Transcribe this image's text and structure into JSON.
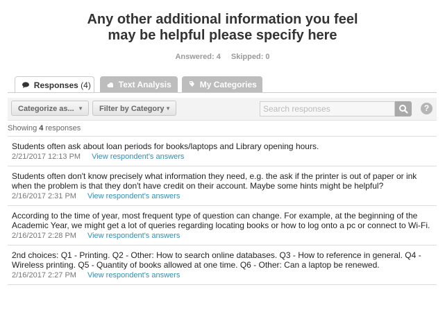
{
  "question": {
    "title_line1": "Any other additional information you feel",
    "title_line2": "may be helpful please specify here"
  },
  "stats": {
    "answered": "Answered: 4",
    "skipped": "Skipped: 0"
  },
  "tabs": [
    {
      "label": "Responses",
      "count": "(4)",
      "icon": "speech-bubble-icon"
    },
    {
      "label": "Text Analysis",
      "icon": "cloud-icon"
    },
    {
      "label": "My Categories",
      "icon": "tag-icon"
    }
  ],
  "toolbar": {
    "categorize_label": "Categorize as...",
    "filter_label": "Filter by Category",
    "search_placeholder": "Search responses",
    "help_label": "?"
  },
  "summary": {
    "prefix": "Showing ",
    "count": "4",
    "suffix": " responses"
  },
  "responses": [
    {
      "text": "Students often ask about loan periods for books/laptops and Library opening hours.",
      "date": "2/21/2017 12:13 PM",
      "link": "View respondent's answers"
    },
    {
      "text": "Students often don't know precisely what information they need, e.g. the ask if the printer is out of paper or ink when the problem is that they don't have credit on their account. Maybe some hints might be helpful?",
      "date": "2/16/2017 2:31 PM",
      "link": "View respondent's answers"
    },
    {
      "text": "According to the time of year, most frequent type of question can change. For example, at the beginning of the Academic Year, we might get a lot of queries regarding locating books or how to log onto a pc or connect to Wi-Fi.",
      "date": "2/16/2017 2:28 PM",
      "link": "View respondent's answers"
    },
    {
      "text": "2nd choices: Q1 - Printing. Q2 - Other: How to search online databases. Q3 - How to reference in general. Q4 - Wireless printing. Q5 - Quantity of books allowed at one time. Q6 - Other: Can a laptop be renewed.",
      "date": "2/16/2017 2:27 PM",
      "link": "View respondent's answers"
    }
  ]
}
